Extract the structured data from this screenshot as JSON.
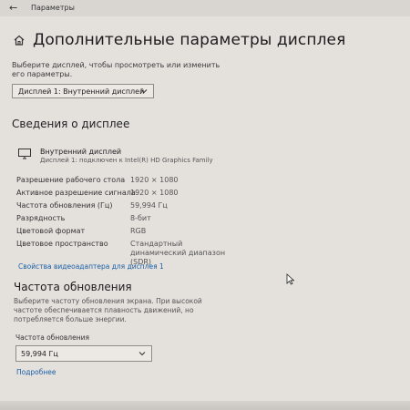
{
  "titlebar": {
    "back_glyph": "←",
    "title": "Параметры"
  },
  "page": {
    "title": "Дополнительные параметры дисплея",
    "intro": "Выберите дисплей, чтобы просмотреть или изменить его параметры.",
    "display_select_value": "Дисплей 1: Внутренний дисплей"
  },
  "display_info": {
    "heading": "Сведения о дисплее",
    "monitor_name": "Внутренний дисплей",
    "monitor_sub": "Дисплей 1: подключен к Intel(R) HD Graphics Family",
    "properties": [
      {
        "label": "Разрешение рабочего стола",
        "value": "1920 × 1080"
      },
      {
        "label": "Активное разрешение сигнала",
        "value": "1920 × 1080"
      },
      {
        "label": "Частота обновления (Гц)",
        "value": "59,994 Гц"
      },
      {
        "label": "Разрядность",
        "value": "8-бит"
      },
      {
        "label": "Цветовой формат",
        "value": "RGB"
      },
      {
        "label": "Цветовое пространство",
        "value": "Стандартный динамический диапазон (SDR)"
      }
    ],
    "adapter_link": "Свойства видеоадаптера для дисплея 1"
  },
  "refresh": {
    "heading": "Частота обновления",
    "description": "Выберите частоту обновления экрана. При высокой частоте обеспечивается плавность движений, но потребляется больше энергии.",
    "field_label": "Частота обновления",
    "value": "59,994 Гц",
    "more_link": "Подробнее"
  },
  "icons": {
    "back": "back-arrow-icon",
    "home": "home-icon",
    "monitor": "monitor-icon",
    "chevron": "chevron-down-icon",
    "cursor": "mouse-cursor-icon"
  },
  "colors": {
    "background": "#e4e1dd",
    "link": "#1b5fa8"
  }
}
